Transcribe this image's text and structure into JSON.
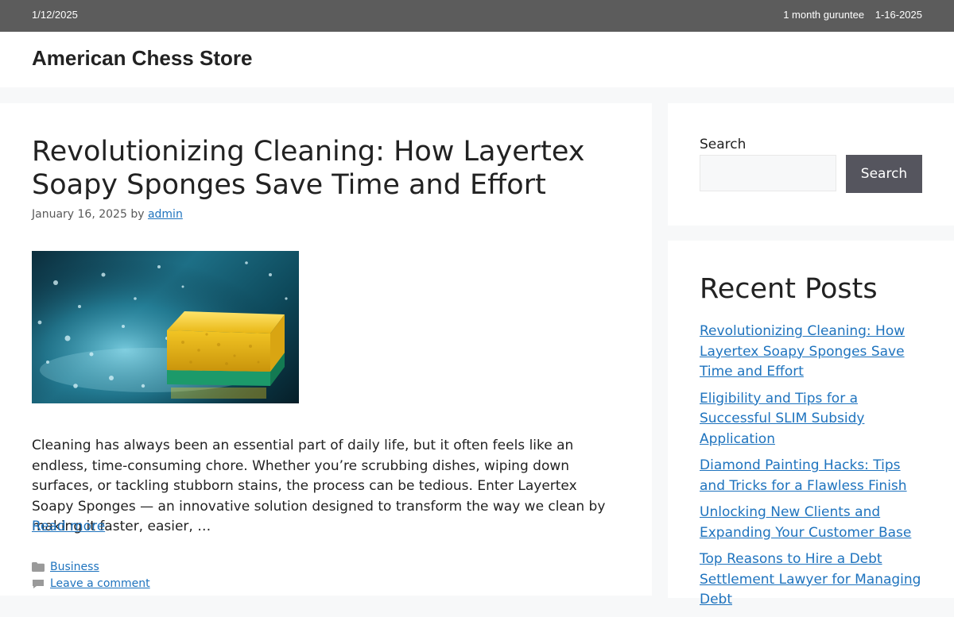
{
  "topbar": {
    "date": "1/12/2025",
    "guarantee": "1 month guruntee",
    "guarantee_date": "1-16-2025"
  },
  "site": {
    "title": "American Chess Store"
  },
  "post": {
    "title": "Revolutionizing Cleaning: How Layertex Soapy Sponges Save Time and Effort",
    "date": "January 16, 2025",
    "by": "by",
    "author": "admin",
    "excerpt": "Cleaning has always been an essential part of daily life, but it often feels like an endless, time-consuming chore. Whether you’re scrubbing dishes, wiping down surfaces, or tackling stubborn stains, the process can be tedious. Enter Layertex Soapy Sponges — an innovative solution designed to transform the way we clean by making it faster, easier, …",
    "read_more": "Read more",
    "category": "Business",
    "comment_link": "Leave a comment"
  },
  "sidebar": {
    "search": {
      "label": "Search",
      "button": "Search",
      "value": ""
    },
    "recent": {
      "title": "Recent Posts",
      "items": [
        "Revolutionizing Cleaning: How Layertex Soapy Sponges Save Time and Effort",
        "Eligibility and Tips for a Successful SLIM Subsidy Application",
        "Diamond Painting Hacks: Tips and Tricks for a Flawless Finish",
        "Unlocking New Clients and Expanding Your Customer Base",
        "Top Reasons to Hire a Debt Settlement Lawyer for Managing Debt"
      ]
    }
  },
  "icons": {
    "category": "folder-icon",
    "comment": "comment-icon"
  },
  "colors": {
    "link": "#1e73be",
    "topbar": "#5c5c5c",
    "search_button": "#55555e"
  }
}
